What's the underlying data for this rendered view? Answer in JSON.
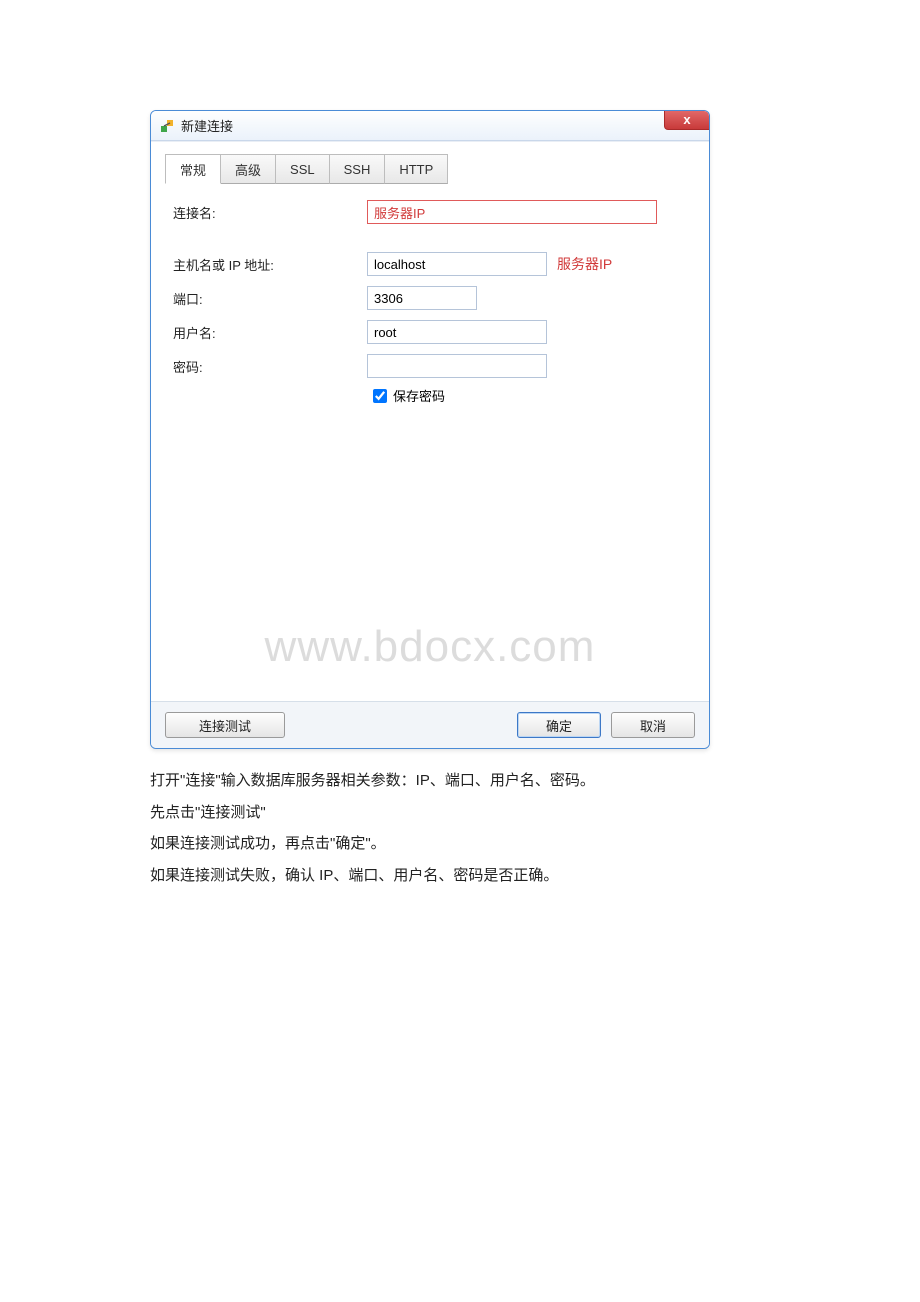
{
  "dialog": {
    "title": "新建连接",
    "close_glyph": "x",
    "tabs": [
      "常规",
      "高级",
      "SSL",
      "SSH",
      "HTTP"
    ],
    "active_tab_index": 0,
    "labels": {
      "conn_name": "连接名:",
      "host": "主机名或 IP 地址:",
      "port": "端口:",
      "user": "用户名:",
      "password": "密码:",
      "save_password": "保存密码"
    },
    "values": {
      "conn_name": "服务器IP",
      "host": "localhost",
      "host_annotation": "服务器IP",
      "port": "3306",
      "user": "root",
      "password": "",
      "save_password_checked": true
    },
    "buttons": {
      "test": "连接测试",
      "ok": "确定",
      "cancel": "取消"
    }
  },
  "watermark": "www.bdocx.com",
  "instructions": [
    "打开\"连接\"输入数据库服务器相关参数：IP、端口、用户名、密码。",
    "先点击\"连接测试\"",
    "如果连接测试成功，再点击\"确定\"。",
    "如果连接测试失败，确认 IP、端口、用户名、密码是否正确。"
  ]
}
